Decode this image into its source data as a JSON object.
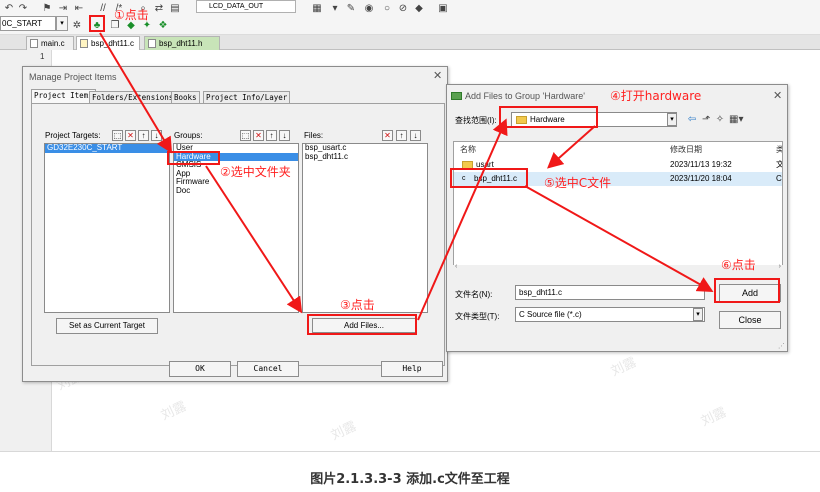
{
  "ide": {
    "target_combo": "0C_START",
    "config_combo": "LCD_DATA_OUT",
    "tabs": [
      {
        "label": "main.c"
      },
      {
        "label": "bsp_dht11.c"
      },
      {
        "label": "bsp_dht11.h"
      }
    ],
    "line_number": "1"
  },
  "manage_dialog": {
    "title": "Manage Project Items",
    "tabs": [
      "Project Items",
      "Folders/Extensions",
      "Books",
      "Project Info/Layer"
    ],
    "targets_label": "Project Targets:",
    "targets": [
      "GD32E230C_START"
    ],
    "groups_label": "Groups:",
    "groups": [
      "User",
      "Hardware",
      "CMSIS",
      "App",
      "Firmware",
      "Doc"
    ],
    "selected_group": "Hardware",
    "files_label": "Files:",
    "files": [
      "bsp_usart.c",
      "bsp_dht11.c"
    ],
    "set_target_button": "Set as Current Target",
    "add_files_button": "Add Files...",
    "ok_button": "OK",
    "cancel_button": "Cancel",
    "help_button": "Help"
  },
  "add_dialog": {
    "title": "Add Files to Group 'Hardware'",
    "look_in_label": "查找范围(I):",
    "look_in_value": "Hardware",
    "columns": [
      "名称",
      "修改日期",
      "类"
    ],
    "rows": [
      {
        "name": "usart",
        "date": "2023/11/13 19:32",
        "type": "文"
      },
      {
        "name": "bsp_dht11.c",
        "date": "2023/11/20 18:04",
        "type": "C"
      }
    ],
    "filename_label": "文件名(N):",
    "filename_value": "bsp_dht11.c",
    "filetype_label": "文件类型(T):",
    "filetype_value": "C Source file (*.c)",
    "add_button": "Add",
    "close_button": "Close"
  },
  "annotations": {
    "step1": "①点击",
    "step2": "②选中文件夹",
    "step3": "③点击",
    "step4": "④打开hardware",
    "step5": "⑤选中C文件",
    "step6": "⑥点击",
    "color": "#ff1f1f"
  },
  "watermark": "刘露",
  "caption": "图片2.1.3.3-3 添加.c文件至工程"
}
